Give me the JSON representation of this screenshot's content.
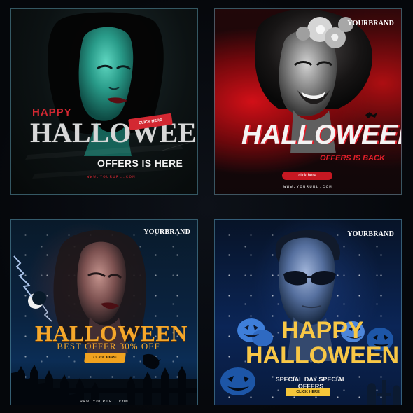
{
  "cards": [
    {
      "prefix": "HAPPY",
      "title": "HALLOWEEN",
      "subtitle": "OFFERS IS HERE",
      "button": "CLICK HERE",
      "url": "WWW.YOURURL.COM",
      "colors": {
        "accent": "#d32832",
        "title": "#d8d8d8",
        "portrait_tint": "#1f8e7a"
      },
      "icons": [
        "witch-portrait-icon",
        "grunge-texture-icon"
      ]
    },
    {
      "brand": "YOURBRAND",
      "title": "HALLOWEEN",
      "subtitle": "OFFERS IS BACK",
      "button": "click here",
      "url": "WWW.YOURURL.COM",
      "colors": {
        "accent": "#e01f2a",
        "title": "#f3f3f3",
        "background": "#b30b10"
      },
      "icons": [
        "smiling-woman-portrait-icon",
        "flower-crown-icon",
        "bat-icon"
      ]
    },
    {
      "brand": "YOURBRAND",
      "title": "HALLOWEEN",
      "subtitle": "BEST OFFER 30% OFF",
      "button": "CLICK HERE",
      "url": "WWW.YOURURL.COM",
      "colors": {
        "accent": "#f0a21f",
        "title": "#f4a72b",
        "background": "#0b2d55"
      },
      "icons": [
        "crescent-moon-icon",
        "lightning-icon",
        "fence-icon",
        "crow-icon",
        "woman-portrait-icon"
      ]
    },
    {
      "brand": "YOURBRAND",
      "title_line_1": "HAPPY",
      "title_line_2": "HALLOWEEN",
      "subtitle": "SPECIAL DAY SPECIAL OFFERS",
      "button": "CLICK HERE",
      "colors": {
        "accent": "#f5c63a",
        "title": "#f8c746",
        "background": "#0b2556"
      },
      "icons": [
        "man-with-sunglasses-icon",
        "jack-o-lantern-icon",
        "pumpkin-icon",
        "tombstone-icon"
      ]
    }
  ]
}
